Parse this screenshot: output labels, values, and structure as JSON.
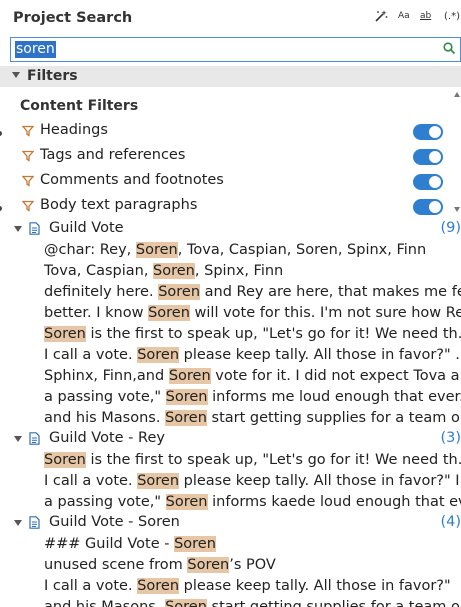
{
  "panel": {
    "title": "Project Search",
    "options": {
      "case_label": "Aa",
      "word_label": "ab",
      "regex_label": "(.*)"
    }
  },
  "search": {
    "value": "soren"
  },
  "filters": {
    "header": "Filters",
    "content_title": "Content Filters",
    "items": [
      {
        "label": "Headings",
        "enabled": true
      },
      {
        "label": "Tags and references",
        "enabled": true
      },
      {
        "label": "Comments and footnotes",
        "enabled": true
      },
      {
        "label": "Body text paragraphs",
        "enabled": true
      }
    ]
  },
  "groups": [
    {
      "title": "Guild Vote",
      "count": "(9)",
      "results": [
        [
          "@char: Rey, ",
          "Soren",
          ", Tova, Caspian, Soren, Spinx, Finn"
        ],
        [
          "Tova, Caspian, ",
          "Soren",
          ", Spinx, Finn"
        ],
        [
          "definitely here. ",
          "Soren",
          " and Rey are here, that makes me fe..."
        ],
        [
          "better. I know ",
          "Soren",
          " will vote for this. I'm not sure how Re..."
        ],
        [
          "",
          "Soren",
          " is the first to speak up, \"Let's go for it! We need th..."
        ],
        [
          "I call a vote. ",
          "Soren",
          " please keep tally. All those in favor?\" ..."
        ],
        [
          "Sphinx, Finn,and ",
          "Soren",
          " vote for it. I did not expect Tova a..."
        ],
        [
          "a passing vote,\" ",
          "Soren",
          " informs me loud enough that ever..."
        ],
        [
          "and his Masons. ",
          "Soren",
          " start getting supplies for a team o..."
        ]
      ]
    },
    {
      "title": "Guild Vote - Rey",
      "count": "(3)",
      "results": [
        [
          "",
          "Soren",
          " is the first to speak up, \"Let's go for it! We need th..."
        ],
        [
          "I call a vote. ",
          "Soren",
          " please keep tally. All those in favor?\" I..."
        ],
        [
          "a passing vote,\" ",
          "Soren",
          " informs kaede loud enough that ev..."
        ]
      ]
    },
    {
      "title": "Guild Vote - Soren",
      "count": "(4)",
      "results": [
        [
          "### Guild Vote - ",
          "Soren",
          ""
        ],
        [
          "unused scene from ",
          "Soren",
          "’s POV"
        ],
        [
          "I call a vote. ",
          "Soren",
          " please keep tally. All those in favor?\""
        ],
        [
          "and his Masons. ",
          "Soren",
          " start getting supplies for a team o..."
        ]
      ]
    }
  ]
}
